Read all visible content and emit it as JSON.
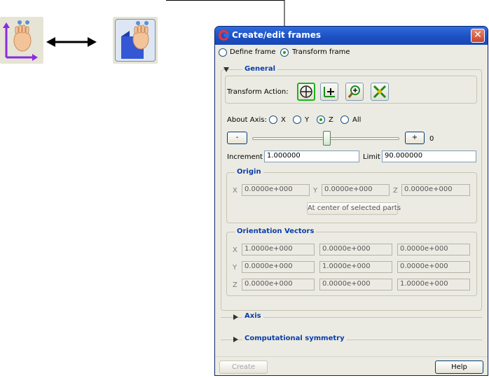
{
  "window": {
    "title": "Create/edit frames",
    "close_glyph": "✕"
  },
  "top_radios": {
    "define_frame": "Define frame",
    "transform_frame": "Transform frame",
    "selected": "transform_frame"
  },
  "general": {
    "title": "General",
    "transform_action_label": "Transform Action:",
    "actions": [
      {
        "icon": "rotate-icon",
        "selected": true
      },
      {
        "icon": "translate-icon",
        "selected": false
      },
      {
        "icon": "zoom-icon",
        "selected": false
      },
      {
        "icon": "scale-icon",
        "selected": false
      }
    ],
    "about_axis_label": "About Axis:",
    "axis_options": [
      "X",
      "Y",
      "Z",
      "All"
    ],
    "axis_selected": "Z",
    "minus_label": "-",
    "plus_label": "+",
    "slider_value": "0",
    "increment_label": "Increment",
    "increment_value": "1.000000",
    "limit_label": "Limit",
    "limit_value": "90.000000"
  },
  "origin": {
    "title": "Origin",
    "x_label": "X",
    "y_label": "Y",
    "z_label": "Z",
    "x": "0.0000e+000",
    "y": "0.0000e+000",
    "z": "0.0000e+000",
    "center_button": "At center of selected parts"
  },
  "orientation": {
    "title": "Orientation Vectors",
    "row_labels": [
      "X",
      "Y",
      "Z"
    ],
    "rows": [
      [
        "1.0000e+000",
        "0.0000e+000",
        "0.0000e+000"
      ],
      [
        "0.0000e+000",
        "1.0000e+000",
        "0.0000e+000"
      ],
      [
        "0.0000e+000",
        "0.0000e+000",
        "1.0000e+000"
      ]
    ]
  },
  "collapsed_sections": [
    "Axis",
    "Computational symmetry"
  ],
  "footer": {
    "create_label": "Create",
    "help_label": "Help"
  },
  "colors": {
    "titlebar": "#1c4fc2",
    "section_title": "#0a3ea8",
    "selected_action_border": "#19b519"
  }
}
